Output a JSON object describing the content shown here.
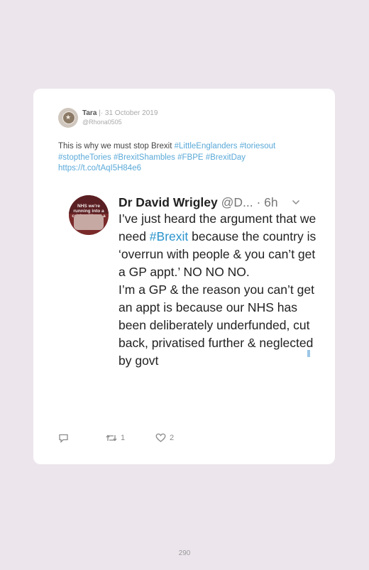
{
  "tweet": {
    "author_name": "Tara",
    "separator": "|·",
    "date": "31 October 2019",
    "handle": "@Rhona0505",
    "text_plain": "This is why we must stop Brexit ",
    "hashtags": [
      "#LittleEnglanders",
      "#toriesout",
      "#stoptheTories",
      "#BrexitShambles",
      "#FBPE",
      "#BrexitDay"
    ],
    "link": "https://t.co/tAqI5H84e6"
  },
  "embedded": {
    "author_name": "Dr David Wrigley",
    "handle": "@D...",
    "time": "· 6h",
    "avatar_caption": "NHS we're running into a crisis without a bed",
    "text_part1": "I’ve just heard the argument that we need ",
    "hashtag": "#Brexit",
    "text_part2": " because the country is ‘overrun with people & you can’t get a GP appt.’  NO NO NO.",
    "text_part3": "I’m a GP & the reason you can’t get an appt is because our NHS has been deliberately underfunded, cut back, privatised further & neglected by govt"
  },
  "actions": {
    "reply_count": "",
    "retweet_count": "1",
    "like_count": "2"
  },
  "page_number": "290",
  "colors": {
    "background": "#ece6ec",
    "card": "#ffffff",
    "link": "#5aa9d8",
    "hashtag_embedded": "#2a93cc"
  },
  "icons": [
    "reply-icon",
    "retweet-icon",
    "heart-icon",
    "chevron-down-icon"
  ]
}
